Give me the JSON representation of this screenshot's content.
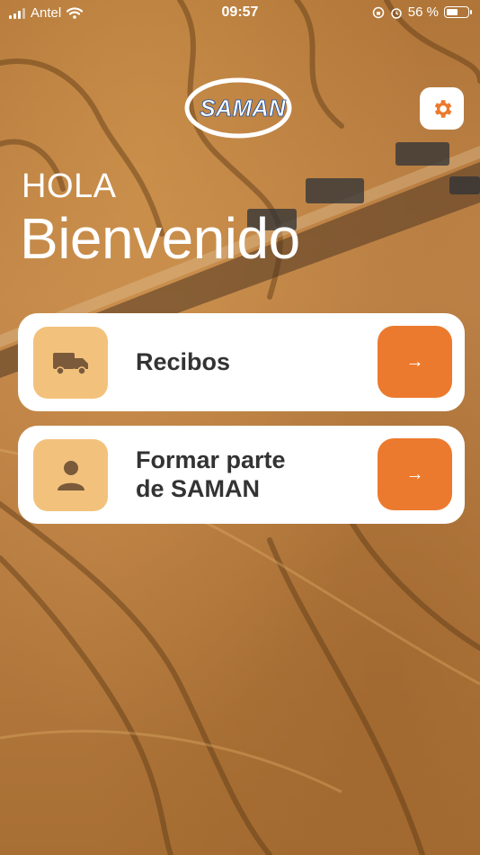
{
  "status_bar": {
    "carrier": "Antel",
    "time": "09:57",
    "battery_percent": "56 %",
    "battery_level": 0.56
  },
  "header": {
    "logo_text": "SAMAN",
    "settings_icon": "gear-icon"
  },
  "hero": {
    "greeting": "HOLA",
    "welcome": "Bienvenido"
  },
  "menu": {
    "items": [
      {
        "label": "Recibos",
        "icon": "truck-icon",
        "arrow": "→"
      },
      {
        "label_line1": "Formar parte",
        "label_line2": "de SAMAN",
        "icon": "person-icon",
        "arrow": "→"
      }
    ]
  },
  "colors": {
    "accent": "#ec7a2e",
    "icon_tile": "#f2c27c",
    "icon_glyph": "#7a5a3a",
    "card_text": "#333333",
    "logo_blue": "#1a4fa0"
  }
}
